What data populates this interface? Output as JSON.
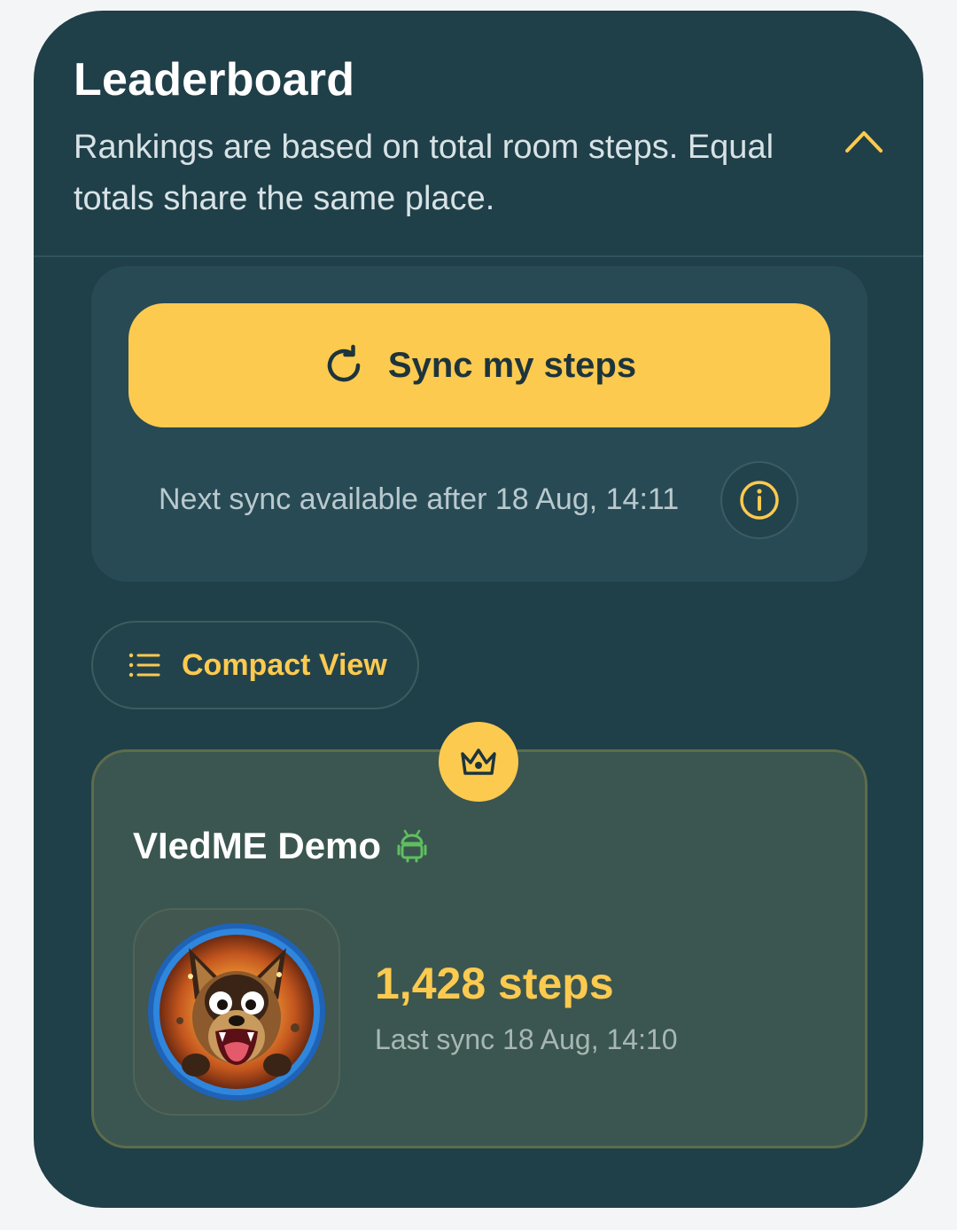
{
  "leaderboard": {
    "title": "Leaderboard",
    "subtitle": "Rankings are based on total room steps. Equal totals share the same place.",
    "collapse_icon": "chevron-up-icon"
  },
  "sync": {
    "button_label": "Sync my steps",
    "button_icon": "refresh-icon",
    "next_sync_text": "Next sync available after 18 Aug, 14:11",
    "info_icon": "info-icon"
  },
  "view_toggle": {
    "label": "Compact View",
    "icon": "list-icon"
  },
  "top_player": {
    "badge_icon": "crown-icon",
    "name": "VIedME Demo",
    "platform_icon": "android-icon",
    "steps": "1,428 steps",
    "last_sync": "Last sync 18 Aug, 14:10"
  },
  "colors": {
    "card_background": "#1f3f49",
    "accent": "#fcca4f",
    "platform_android": "#5fbf5f"
  }
}
